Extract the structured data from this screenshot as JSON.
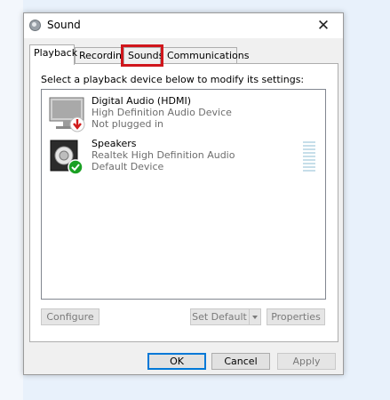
{
  "window": {
    "title": "Sound",
    "close_glyph": "✕"
  },
  "tabs": [
    {
      "label": "Playback",
      "active": true
    },
    {
      "label": "Recording"
    },
    {
      "label": "Sounds",
      "highlighted": true
    },
    {
      "label": "Communications"
    }
  ],
  "panel": {
    "instructions": "Select a playback device below to modify its settings:"
  },
  "devices": [
    {
      "name": "Digital Audio (HDMI)",
      "driver": "High Definition Audio Device",
      "status": "Not plugged in",
      "icon": "monitor-icon",
      "status_icon": "disconnected-badge-icon"
    },
    {
      "name": "Speakers",
      "driver": "Realtek High Definition Audio",
      "status": "Default Device",
      "icon": "speaker-icon",
      "status_icon": "default-check-icon"
    }
  ],
  "buttons": {
    "configure": "Configure",
    "set_default": "Set Default",
    "properties": "Properties",
    "ok": "OK",
    "cancel": "Cancel",
    "apply": "Apply"
  },
  "colors": {
    "highlight": "#d0161c",
    "default_button_border": "#0078d7",
    "check_badge": "#1aa023",
    "unplugged_badge": "#d01b1b"
  }
}
